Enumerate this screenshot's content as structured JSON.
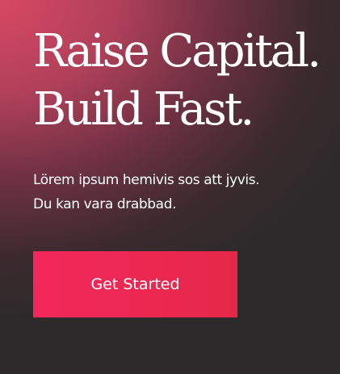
{
  "hero": {
    "headline_line1": "Raise Capital.",
    "headline_line2": "Build Fast.",
    "subtext_line1": "Lörem ipsum hemivis sos att jyvis.",
    "subtext_line2": "Du kan vara drabbad.",
    "cta_label": "Get Started"
  },
  "colors": {
    "background_accent": "#d84863",
    "background_dark": "#2e2a2b",
    "button_start": "#f2285c",
    "button_end": "#e62848",
    "text": "#ffffff"
  }
}
